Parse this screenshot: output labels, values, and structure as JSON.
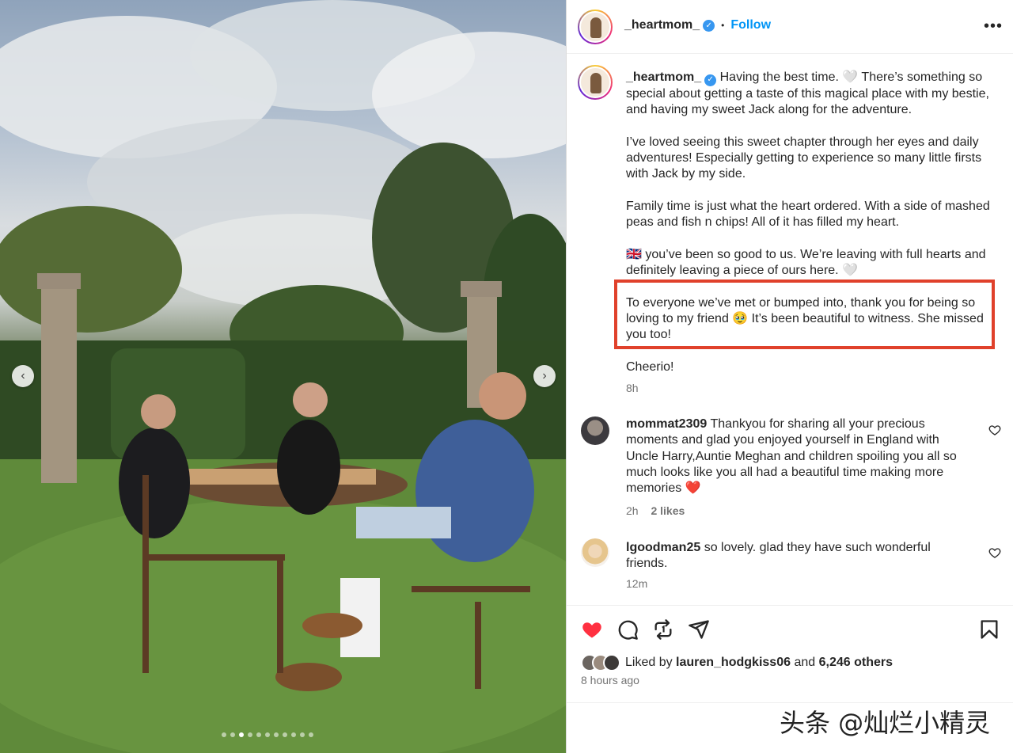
{
  "post": {
    "username": "_heartmom_",
    "follow_label": "Follow",
    "separator": "•",
    "more_label": "•••"
  },
  "caption": {
    "paragraphs": [
      "Having the best time. 🤍 There’s something so special about getting a taste of this magical place with my bestie, and having my sweet Jack along for the adventure.",
      "I’ve loved seeing this sweet chapter through her eyes and daily adventures! Especially getting to experience so many little firsts with Jack by my side.",
      "Family time is just what the heart ordered. With a side of mashed peas and fish n chips! All of it has filled my heart.",
      "🇬🇧 you’ve been so good to us. We’re leaving with full hearts and definitely leaving a piece of ours here. 🤍",
      "To everyone we’ve met or bumped into, thank you for being so loving to my friend 🥹 It’s been beautiful to witness. She missed you too!",
      "Cheerio!"
    ],
    "time": "8h"
  },
  "comments": [
    {
      "username": "mommat2309",
      "text": "Thankyou for sharing all your precious moments and glad you enjoyed yourself in England with Uncle Harry,Auntie Meghan and children spoiling you all so much looks like you all had a beautiful time making more memories ❤️",
      "time": "2h",
      "likes": "2 likes"
    },
    {
      "username": "lgoodman25",
      "text": "so lovely. glad they have such wonderful friends.",
      "time": "12m",
      "likes": ""
    }
  ],
  "likes": {
    "prefix": "Liked by",
    "user": "lauren_hodgkiss06",
    "connector": "and",
    "others": "6,246 others"
  },
  "posted_ago": "8 hours ago",
  "comment_input": {
    "placeholder": ""
  },
  "carousel": {
    "prev_label": "‹",
    "next_label": "›",
    "slide_count": 11,
    "active_index": 2
  },
  "watermark": "头条 @灿烂小精灵",
  "colors": {
    "accent": "#0095f6",
    "verified": "#3797f0",
    "like_red": "#ff3040",
    "highlight_border": "#e0412b"
  },
  "icons": {
    "like": "heart-icon",
    "comment": "comment-bubble-icon",
    "share": "repost-icon",
    "send": "send-icon",
    "save": "bookmark-icon"
  }
}
